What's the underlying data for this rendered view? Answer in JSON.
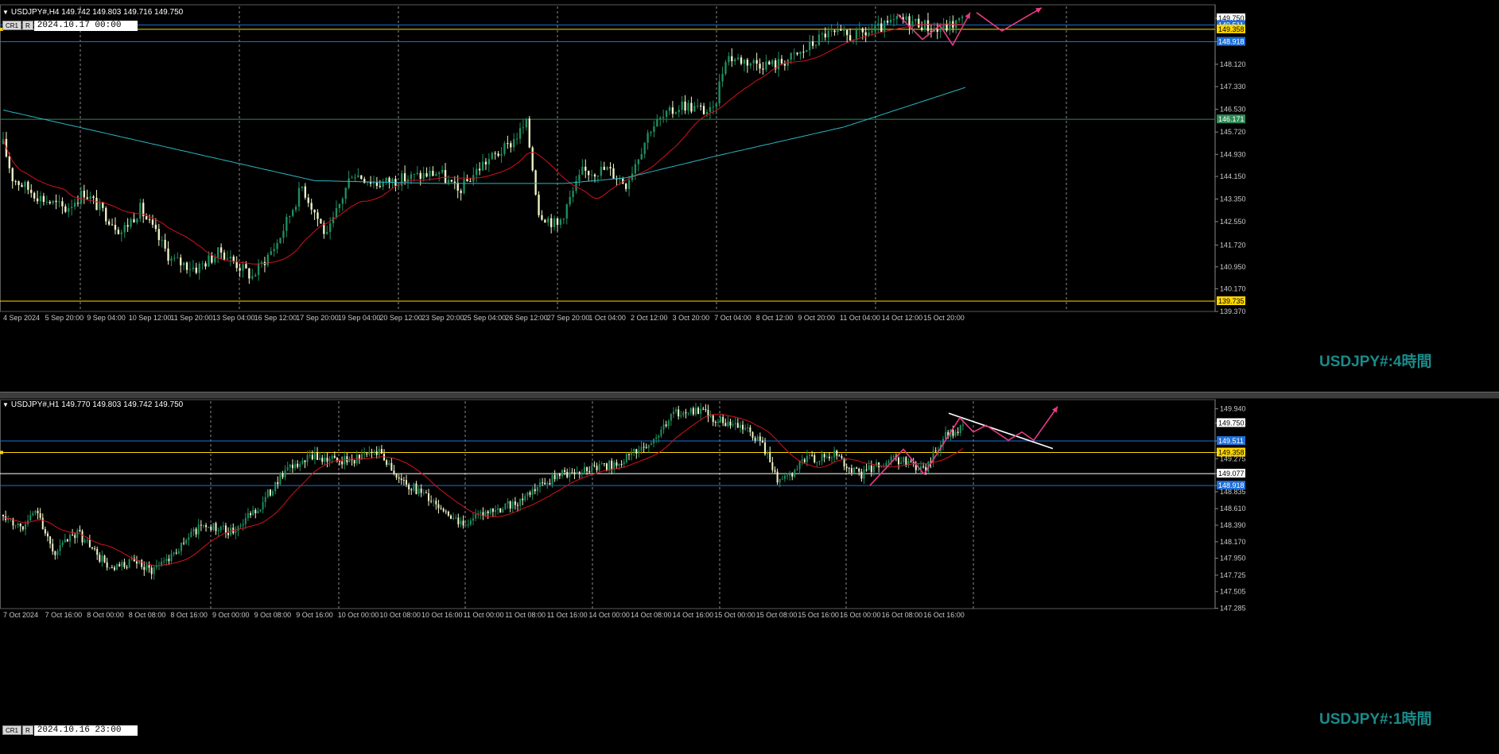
{
  "colors": {
    "background": "#000000",
    "grid": "#8a8a8a",
    "axis_text": "#c8c8c8",
    "bull_candle": "#1f8f5f",
    "bear_candle": "#f0f5c8",
    "ma_fast": "#d4121c",
    "ma_slow": "#2ab7c4",
    "level_yellow": "#ffd700",
    "level_blue": "#1f6fd8",
    "level_white": "#ffffff",
    "level_green": "#2e8b57",
    "forecast_pink": "#e83a86",
    "trendline": "#ffffff",
    "tf_label": "#1a8b8b"
  },
  "h4": {
    "header": "USDJPY#,H4  149.742 149.803 149.716 149.750",
    "crosshair_tag1": "CR1",
    "crosshair_tag2": "R",
    "crosshair_time": "2024.10.17 00:00",
    "timeframe_label": "USDJPY#:4時間",
    "y_range": [
      139.37,
      150.17
    ],
    "y_ticks": [
      "149.750",
      "148.918",
      "148.120",
      "147.330",
      "146.530",
      "145.720",
      "144.930",
      "144.150",
      "143.350",
      "142.550",
      "141.720",
      "140.950",
      "140.170",
      "139.370"
    ],
    "x_ticks": [
      "4 Sep 2024",
      "5 Sep 20:00",
      "9 Sep 04:00",
      "10 Sep 12:00",
      "11 Sep 20:00",
      "13 Sep 04:00",
      "16 Sep 12:00",
      "17 Sep 20:00",
      "19 Sep 04:00",
      "20 Sep 12:00",
      "23 Sep 20:00",
      "25 Sep 04:00",
      "26 Sep 12:00",
      "27 Sep 20:00",
      "1 Oct 04:00",
      "2 Oct 12:00",
      "3 Oct 20:00",
      "7 Oct 04:00",
      "8 Oct 12:00",
      "9 Oct 20:00",
      "11 Oct 04:00",
      "14 Oct 12:00",
      "15 Oct 20:00"
    ],
    "price_tags": [
      {
        "value": 149.75,
        "text": "149.750",
        "kind": "white"
      },
      {
        "value": 149.511,
        "text": "149.511",
        "kind": "blue"
      },
      {
        "value": 149.358,
        "text": "149.358",
        "kind": "yellow"
      },
      {
        "value": 148.918,
        "text": "148.918",
        "kind": "blue"
      },
      {
        "value": 146.171,
        "text": "146.171",
        "kind": "green"
      },
      {
        "value": 139.735,
        "text": "139.735",
        "kind": "yellow"
      }
    ]
  },
  "h1": {
    "header": "USDJPY#,H1  149.770 149.803 149.742 149.750",
    "crosshair_tag1": "CR1",
    "crosshair_tag2": "R",
    "crosshair_time": "2024.10.16 23:00",
    "timeframe_label": "USDJPY#:1時間",
    "y_range": [
      147.28,
      150.04
    ],
    "y_ticks": [
      "149.940",
      "149.750",
      "149.511",
      "149.358",
      "149.275",
      "149.077",
      "148.918",
      "148.835",
      "148.610",
      "148.390",
      "148.170",
      "147.950",
      "147.725",
      "147.505",
      "147.285"
    ],
    "x_ticks": [
      "7 Oct 2024",
      "7 Oct 16:00",
      "8 Oct 00:00",
      "8 Oct 08:00",
      "8 Oct 16:00",
      "9 Oct 00:00",
      "9 Oct 08:00",
      "9 Oct 16:00",
      "10 Oct 00:00",
      "10 Oct 08:00",
      "10 Oct 16:00",
      "11 Oct 00:00",
      "11 Oct 08:00",
      "11 Oct 16:00",
      "14 Oct 00:00",
      "14 Oct 08:00",
      "14 Oct 16:00",
      "15 Oct 00:00",
      "15 Oct 08:00",
      "15 Oct 16:00",
      "16 Oct 00:00",
      "16 Oct 08:00",
      "16 Oct 16:00"
    ],
    "price_tags": [
      {
        "value": 149.75,
        "text": "149.750",
        "kind": "white"
      },
      {
        "value": 149.511,
        "text": "149.511",
        "kind": "blue"
      },
      {
        "value": 149.358,
        "text": "149.358",
        "kind": "yellow"
      },
      {
        "value": 149.077,
        "text": "149.077",
        "kind": "white"
      },
      {
        "value": 148.918,
        "text": "148.918",
        "kind": "blue"
      }
    ]
  }
}
